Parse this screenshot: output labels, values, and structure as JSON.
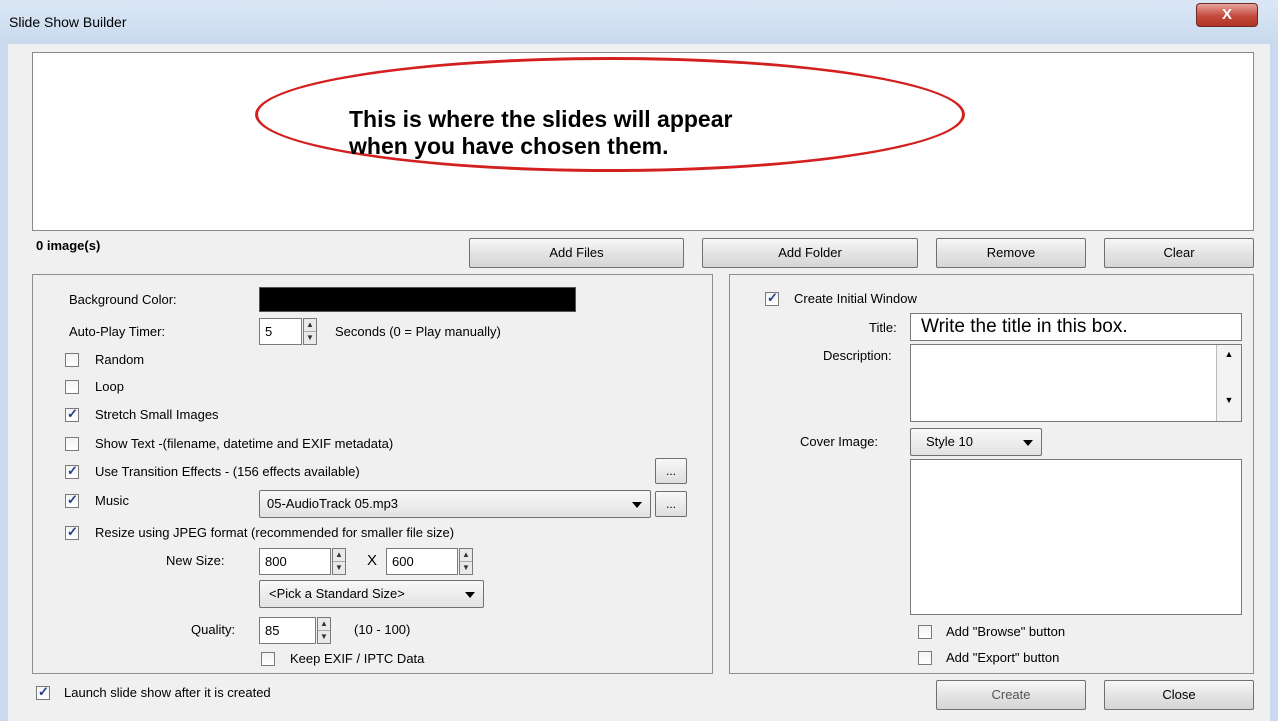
{
  "window": {
    "title": "Slide Show Builder",
    "close_glyph": "X"
  },
  "preview": {
    "message_line1": "This is where the slides will appear",
    "message_line2": "when you have chosen them."
  },
  "image_count": "0 image(s)",
  "file_buttons": {
    "add_files": "Add Files",
    "add_folder": "Add Folder",
    "remove": "Remove",
    "clear": "Clear"
  },
  "left_panel": {
    "background_color_label": "Background Color:",
    "background_color_value": "#000000",
    "timer_label": "Auto-Play Timer:",
    "timer_value": "5",
    "timer_hint": "Seconds (0 = Play  manually)",
    "random_label": "Random",
    "random_checked": false,
    "loop_label": "Loop",
    "loop_checked": false,
    "stretch_label": "Stretch Small Images",
    "stretch_checked": true,
    "show_text_label": "Show Text -(filename, datetime and EXIF metadata)",
    "show_text_checked": false,
    "transition_label": "Use Transition Effects   -    (156 effects available)",
    "transition_checked": true,
    "more_button": "...",
    "music_label": "Music",
    "music_checked": true,
    "music_value": "05-AudioTrack 05.mp3",
    "resize_label": "Resize using JPEG format (recommended for smaller file size)",
    "resize_checked": true,
    "new_size_label": "New Size:",
    "width_value": "800",
    "times_symbol": "X",
    "height_value": "600",
    "standard_size_value": "<Pick a Standard Size>",
    "quality_label": "Quality:",
    "quality_value": "85",
    "quality_range": "(10 - 100)",
    "keep_exif_label": "Keep EXIF / IPTC Data",
    "keep_exif_checked": false
  },
  "right_panel": {
    "create_initial_label": "Create Initial Window",
    "create_initial_checked": true,
    "title_label": "Title:",
    "title_value": "Write the title in this box.",
    "description_label": "Description:",
    "cover_image_label": "Cover Image:",
    "cover_image_value": "Style 10",
    "browse_label": "Add \"Browse\" button",
    "browse_checked": false,
    "export_label": "Add \"Export\" button",
    "export_checked": false
  },
  "footer": {
    "launch_label": "Launch slide show after it is created",
    "launch_checked": true,
    "create_button": "Create",
    "close_button": "Close"
  },
  "icons": {
    "checkbox_check": "check-icon",
    "spin_up": "spin-up-icon",
    "spin_down": "spin-down-icon",
    "dropdown": "chevron-down-icon"
  }
}
